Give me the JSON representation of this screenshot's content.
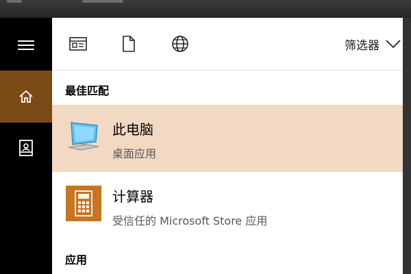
{
  "toolbar": {
    "filter_label": "筛选器"
  },
  "icons": {
    "menu": "hamburger-icon",
    "home": "home-icon",
    "notebook": "notebook-icon",
    "documents_view": "document-view-icon",
    "file": "file-icon",
    "web": "globe-icon",
    "filter_chevron": "chevron-down-icon"
  },
  "results": {
    "best_match_header": "最佳匹配",
    "best_match": {
      "title": "此电脑",
      "subtitle": "桌面应用"
    },
    "second": {
      "title": "计算器",
      "subtitle": "受信任的 Microsoft Store 应用"
    },
    "apps_header": "应用"
  },
  "colors": {
    "rail_bg": "#000000",
    "rail_active": "#7a4a17",
    "selected_row": "#f2d9c3",
    "calculator_tile": "#c9741e"
  }
}
